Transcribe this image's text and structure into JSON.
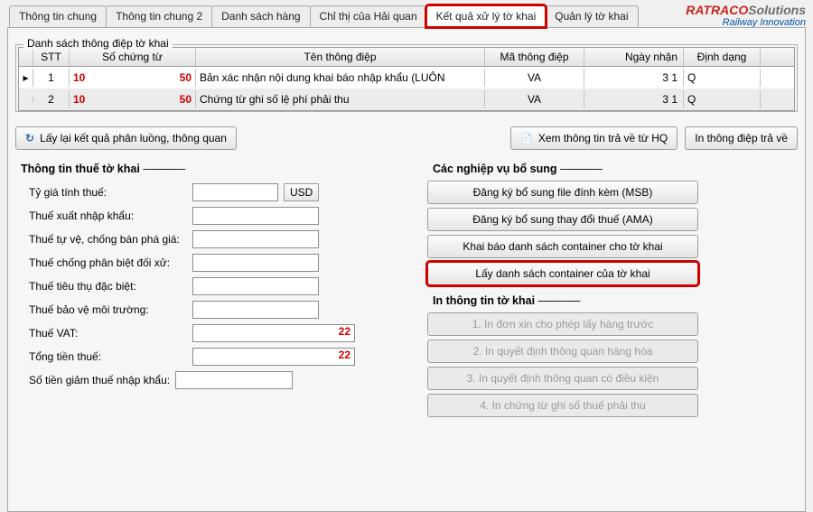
{
  "logo": {
    "brand1": "RATRACO",
    "brand2": "Solutions",
    "sub": "Railway Innovation"
  },
  "tabs": [
    {
      "label": "Thông tin chung"
    },
    {
      "label": "Thông tin chung 2"
    },
    {
      "label": "Danh sách hàng"
    },
    {
      "label": "Chỉ thị của Hải quan"
    },
    {
      "label": "Kết quả xử lý tờ khai"
    },
    {
      "label": "Quản lý tờ khai"
    }
  ],
  "grid": {
    "title": "Danh sách thông điệp tờ khai",
    "headers": {
      "stt": "STT",
      "soct": "Số chứng từ",
      "ten": "Tên thông điệp",
      "ma": "Mã thông điệp",
      "ngay": "Ngày nhận",
      "dd": "Định dạng"
    },
    "rows": [
      {
        "stt": "1",
        "soct_a": "10",
        "soct_b": "50",
        "ten": "Bản xác nhận nội dung khai báo nhập khẩu (LUÔN",
        "ma": "VA",
        "ngay": "3 1",
        "dd": "Q"
      },
      {
        "stt": "2",
        "soct_a": "10",
        "soct_b": "50",
        "ten": "Chứng từ ghi số lệ phí phải thu",
        "ma": "VA",
        "ngay": "3 1",
        "dd": "Q"
      }
    ]
  },
  "buttons": {
    "refresh": "Lấy lại kết quả phân luồng, thông quan",
    "viewhq": "Xem thông tin trả về từ HQ",
    "printmsg": "In thông điệp trả về"
  },
  "tax": {
    "title": "Thông tin thuế tờ khai",
    "rows": {
      "rate": "Tỷ giá tính thuế:",
      "xnk": "Thuế xuất nhập khẩu:",
      "tv": "Thuế tự vệ, chống bán phá giá:",
      "pb": "Thuế chống phân biệt đối xử:",
      "ttd": "Thuế tiêu thụ đặc biệt:",
      "bvmt": "Thuế bảo vệ môi trường:",
      "vat": "Thuế VAT:",
      "total": "Tổng tiền thuế:",
      "giam": "Số tiền giảm thuế nhập khẩu:"
    },
    "currency": "USD",
    "vat_val": "22",
    "total_val": "22"
  },
  "ops": {
    "title": "Các nghiệp vụ bổ sung",
    "b1": "Đăng ký bổ sung file đính kèm (MSB)",
    "b2": "Đăng ký bổ sung thay đổi thuế (AMA)",
    "b3": "Khai báo danh sách container cho tờ khai",
    "b4": "Lấy danh sách container của tờ khai"
  },
  "print": {
    "title": "In thông tin tờ khai",
    "b1": "1. In đơn xin cho phép lấy hàng trước",
    "b2": "2. In quyết định thông quan hàng hóa",
    "b3": "3. In quyết định thông quan có điều kiện",
    "b4": "4. In chứng từ ghi số thuế phải thu"
  }
}
